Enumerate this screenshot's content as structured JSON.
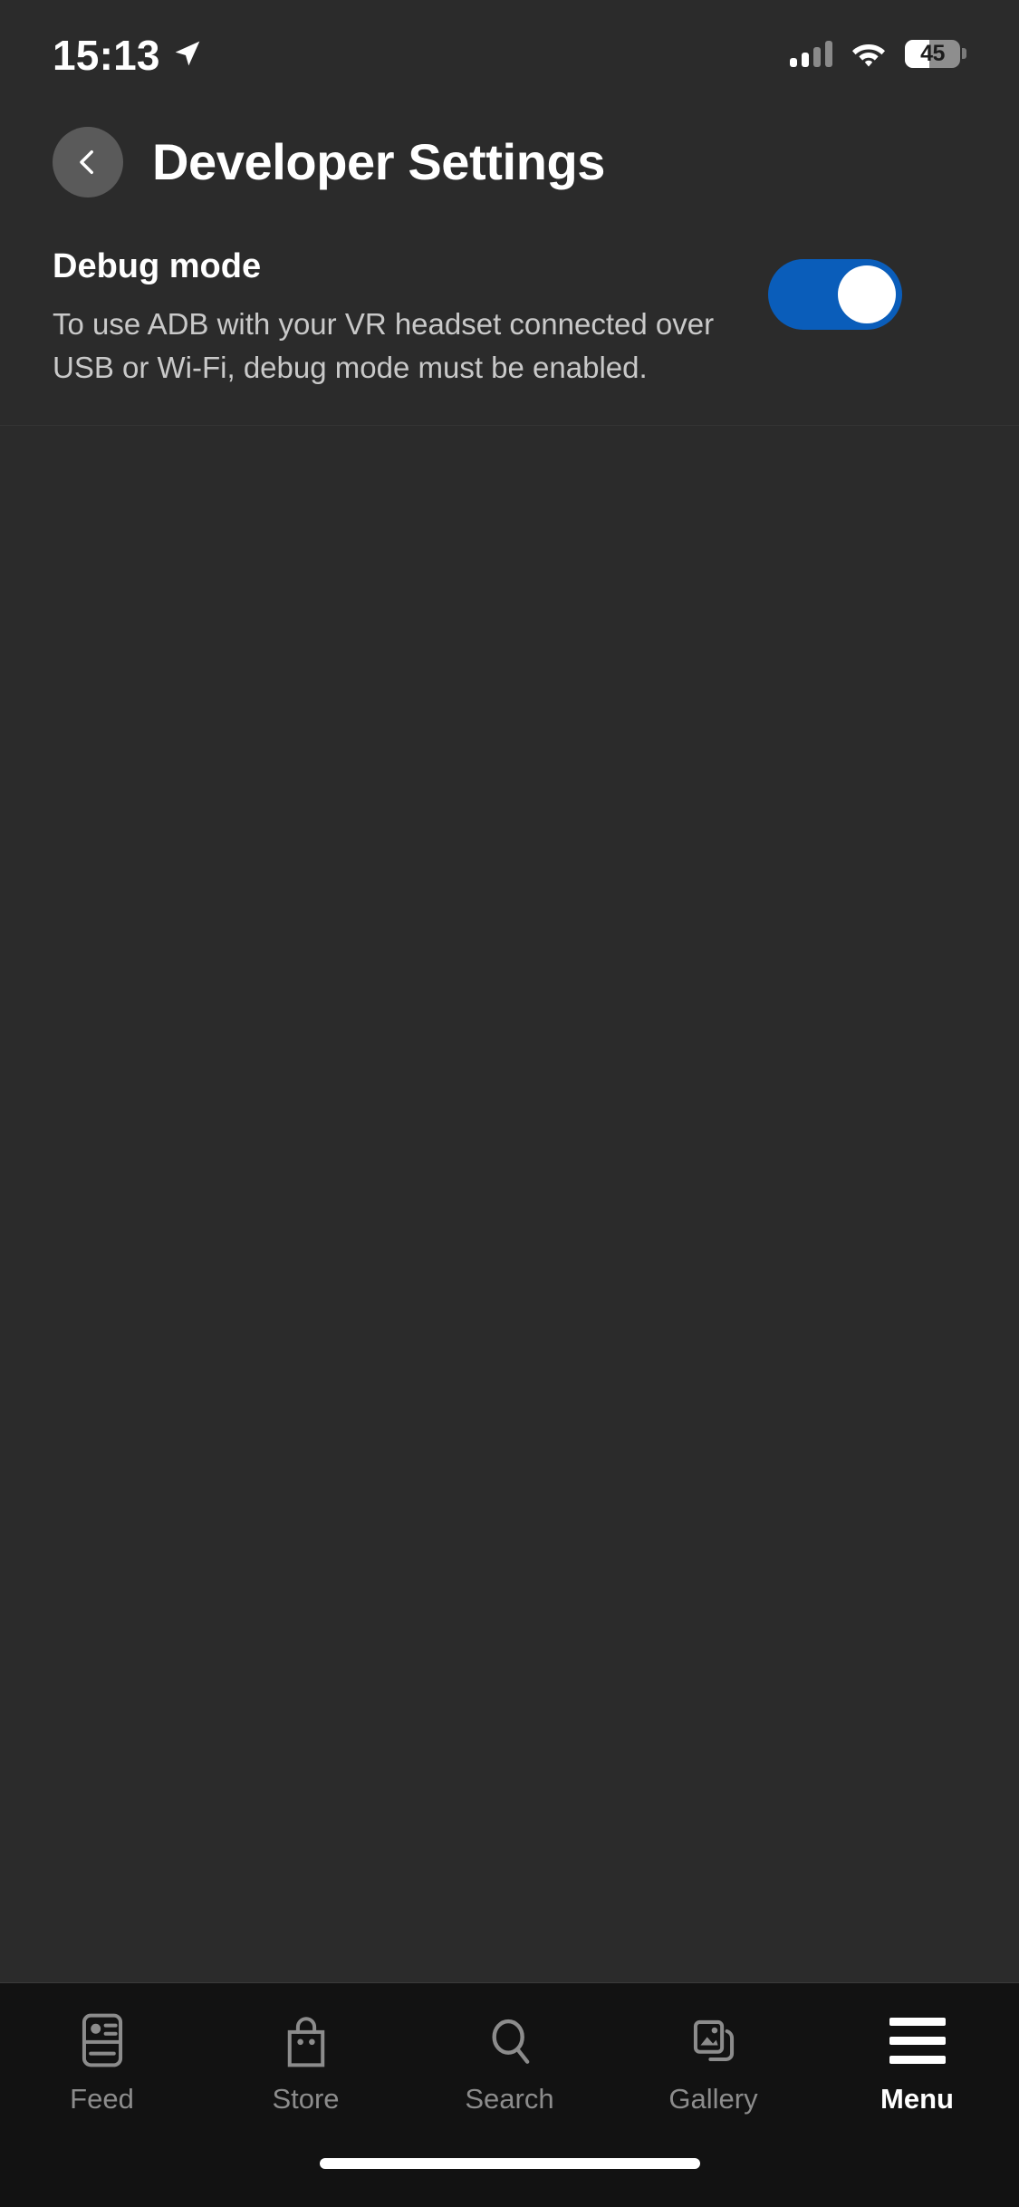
{
  "status_bar": {
    "time": "15:13",
    "location_icon": "location-arrow-icon",
    "signal_icon": "cellular-signal-icon",
    "signal_bars_filled": 2,
    "signal_bars_total": 4,
    "wifi_icon": "wifi-icon",
    "battery_icon": "battery-icon",
    "battery_percent": "45",
    "battery_level": 45
  },
  "header": {
    "back_icon": "chevron-left-icon",
    "back_label": "Back",
    "title": "Developer Settings"
  },
  "settings": {
    "rows": [
      {
        "title": "Debug mode",
        "description": "To use ADB with your VR headset connected over USB or Wi-Fi, debug mode must be enabled.",
        "toggle_state": "on",
        "toggle_on_color": "#0a5dba",
        "toggle_knob_color": "#ffffff"
      }
    ]
  },
  "bottom_nav": {
    "items": [
      {
        "label": "Feed",
        "icon": "feed-card-icon",
        "active": false
      },
      {
        "label": "Store",
        "icon": "shopping-bag-icon",
        "active": false
      },
      {
        "label": "Search",
        "icon": "magnifier-icon",
        "active": false
      },
      {
        "label": "Gallery",
        "icon": "images-icon",
        "active": false
      },
      {
        "label": "Menu",
        "icon": "hamburger-menu-icon",
        "active": true
      }
    ],
    "active_index": 4,
    "inactive_color": "#8c8c8c",
    "active_color": "#ffffff"
  },
  "system": {
    "home_indicator": "home-indicator"
  },
  "theme": {
    "background": "#2b2b2b",
    "nav_background": "#121212",
    "accent": "#0a5dba",
    "text_primary": "#ffffff",
    "text_secondary": "#c9c9c9"
  }
}
